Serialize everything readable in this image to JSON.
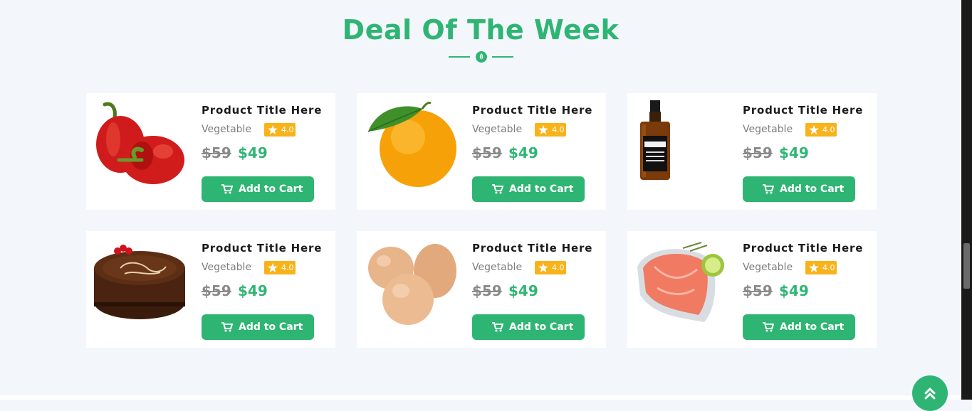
{
  "section": {
    "title": "Deal Of The Week"
  },
  "colors": {
    "accent": "#2fb573",
    "rating": "#f9b31a",
    "old_price": "#8a8a8a"
  },
  "products": [
    {
      "image": "red-bell-pepper-image",
      "title": "Product Title Here",
      "category": "Vegetable",
      "rating": "4.0",
      "old_price": "$59",
      "price": "$49",
      "button": "Add to Cart"
    },
    {
      "image": "orange-fruit-image",
      "title": "Product Title Here",
      "category": "Vegetable",
      "rating": "4.0",
      "old_price": "$59",
      "price": "$49",
      "button": "Add to Cart"
    },
    {
      "image": "whiskey-bottle-image",
      "title": "Product Title Here",
      "category": "Vegetable",
      "rating": "4.0",
      "old_price": "$59",
      "price": "$49",
      "button": "Add to Cart"
    },
    {
      "image": "chocolate-birthday-cake-image",
      "title": "Product Title Here",
      "category": "Vegetable",
      "rating": "4.0",
      "old_price": "$59",
      "price": "$49",
      "button": "Add to Cart"
    },
    {
      "image": "eggs-image",
      "title": "Product Title Here",
      "category": "Vegetable",
      "rating": "4.0",
      "old_price": "$59",
      "price": "$49",
      "button": "Add to Cart"
    },
    {
      "image": "salmon-steak-image",
      "title": "Product Title Here",
      "category": "Vegetable",
      "rating": "4.0",
      "old_price": "$59",
      "price": "$49",
      "button": "Add to Cart"
    }
  ],
  "icons": {
    "divider": "leaf-icon",
    "rating": "star-icon",
    "cart": "cart-icon",
    "scroll_top": "double-chevron-up-icon"
  }
}
